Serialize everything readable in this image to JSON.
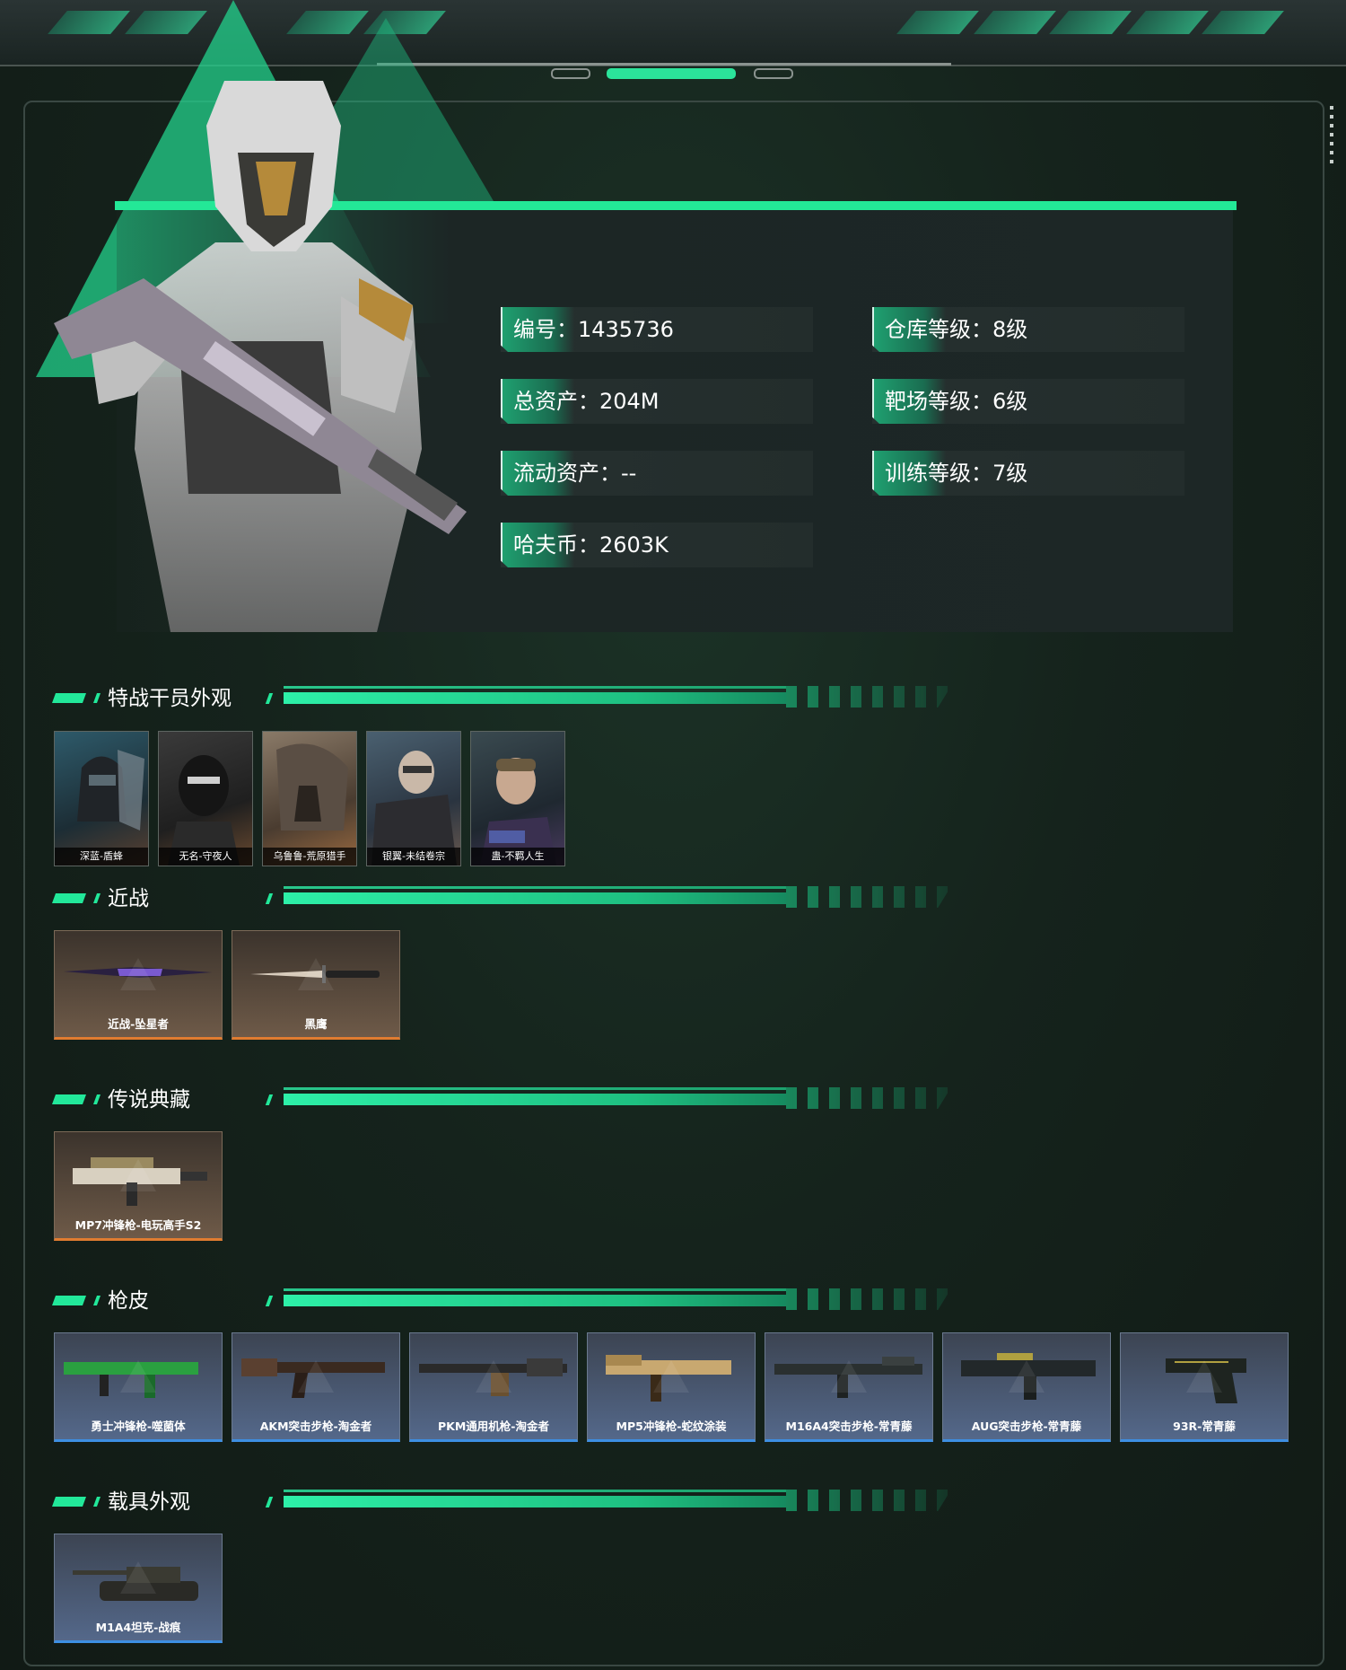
{
  "hero": {
    "stats": [
      {
        "label": "编号：1435736"
      },
      {
        "label": "仓库等级：8级"
      },
      {
        "label": "总资产：204M"
      },
      {
        "label": "靶场等级：6级"
      },
      {
        "label": "流动资产：--"
      },
      {
        "label": "训练等级：7级"
      },
      {
        "label": "哈夫币：2603K"
      }
    ]
  },
  "sections": {
    "agents": {
      "title": "特战干员外观",
      "items": [
        "深蓝-盾蜂",
        "无名-守夜人",
        "乌鲁鲁-荒原猎手",
        "银翼-未结卷宗",
        "蛊-不羁人生"
      ]
    },
    "melee": {
      "title": "近战",
      "items": [
        "近战-坠星者",
        "黑鹰"
      ]
    },
    "legend": {
      "title": "传说典藏",
      "items": [
        "MP7冲锋枪-电玩高手S2"
      ]
    },
    "skins": {
      "title": "枪皮",
      "items": [
        "勇士冲锋枪-噬菌体",
        "AKM突击步枪-淘金者",
        "PKM通用机枪-淘金者",
        "MP5冲锋枪-蛇纹涂装",
        "M16A4突击步枪-常青藤",
        "AUG突击步枪-常青藤",
        "93R-常青藤"
      ]
    },
    "vehicles": {
      "title": "载具外观",
      "items": [
        "M1A4坦克-战痕"
      ]
    }
  },
  "colors": {
    "accent": "#23e897",
    "legendary_border": "#e07c30",
    "rare_border": "#3d8fe3"
  }
}
